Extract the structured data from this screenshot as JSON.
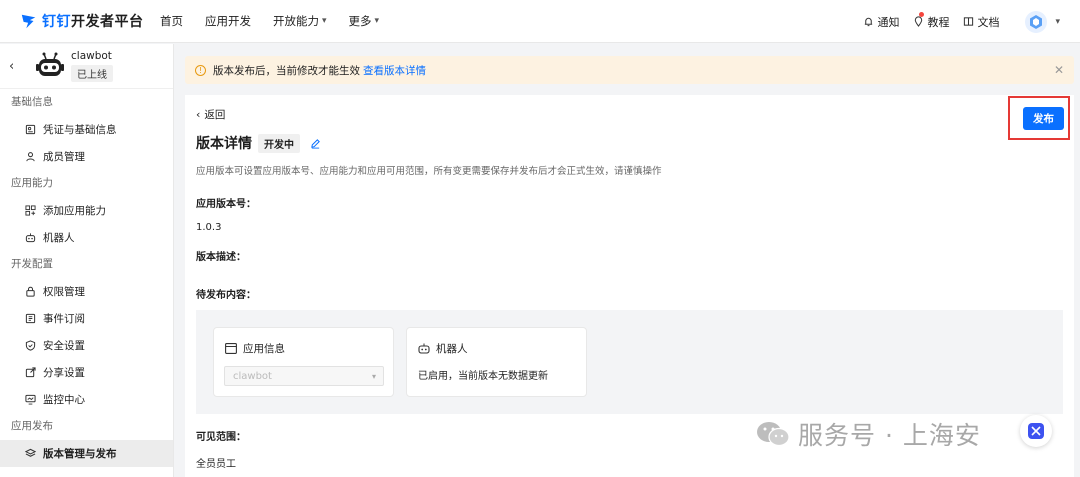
{
  "header": {
    "brand_name": "钉钉",
    "brand_suffix": "开发者平台",
    "nav": [
      {
        "label": "首页"
      },
      {
        "label": "应用开发"
      },
      {
        "label": "开放能力"
      },
      {
        "label": "更多"
      }
    ],
    "notify_label": "通知",
    "tutorial_label": "教程",
    "docs_label": "文档"
  },
  "sidebar": {
    "app_name": "clawbot",
    "app_status": "已上线",
    "sections": [
      {
        "title": "基础信息",
        "items": [
          "凭证与基础信息",
          "成员管理"
        ]
      },
      {
        "title": "应用能力",
        "items": [
          "添加应用能力",
          "机器人"
        ]
      },
      {
        "title": "开发配置",
        "items": [
          "权限管理",
          "事件订阅",
          "安全设置",
          "分享设置",
          "监控中心"
        ]
      },
      {
        "title": "应用发布",
        "items": [
          "版本管理与发布"
        ]
      }
    ]
  },
  "banner": {
    "text": "版本发布后，当前修改才能生效",
    "link": "查看版本详情"
  },
  "main": {
    "back_label": "返回",
    "title": "版本详情",
    "status_tag": "开发中",
    "description": "应用版本可设置应用版本号、应用能力和应用可用范围，所有变更需要保存并发布后才会正式生效，请谨慎操作",
    "version_label": "应用版本号：",
    "version_value": "1.0.3",
    "version_desc_label": "版本描述：",
    "pending_label": "待发布内容：",
    "cards": {
      "app_info_title": "应用信息",
      "app_info_select": "clawbot",
      "robot_title": "机器人",
      "robot_text": "已启用，当前版本无数据更新"
    },
    "scope_label": "可见范围：",
    "scope_value": "全员员工",
    "publish_label": "发布"
  },
  "watermark": {
    "text": "服务号 · 上海安"
  },
  "colors": {
    "accent": "#0a70ff",
    "highlight_box": "#e53935",
    "banner_bg": "#fdf2e1"
  }
}
